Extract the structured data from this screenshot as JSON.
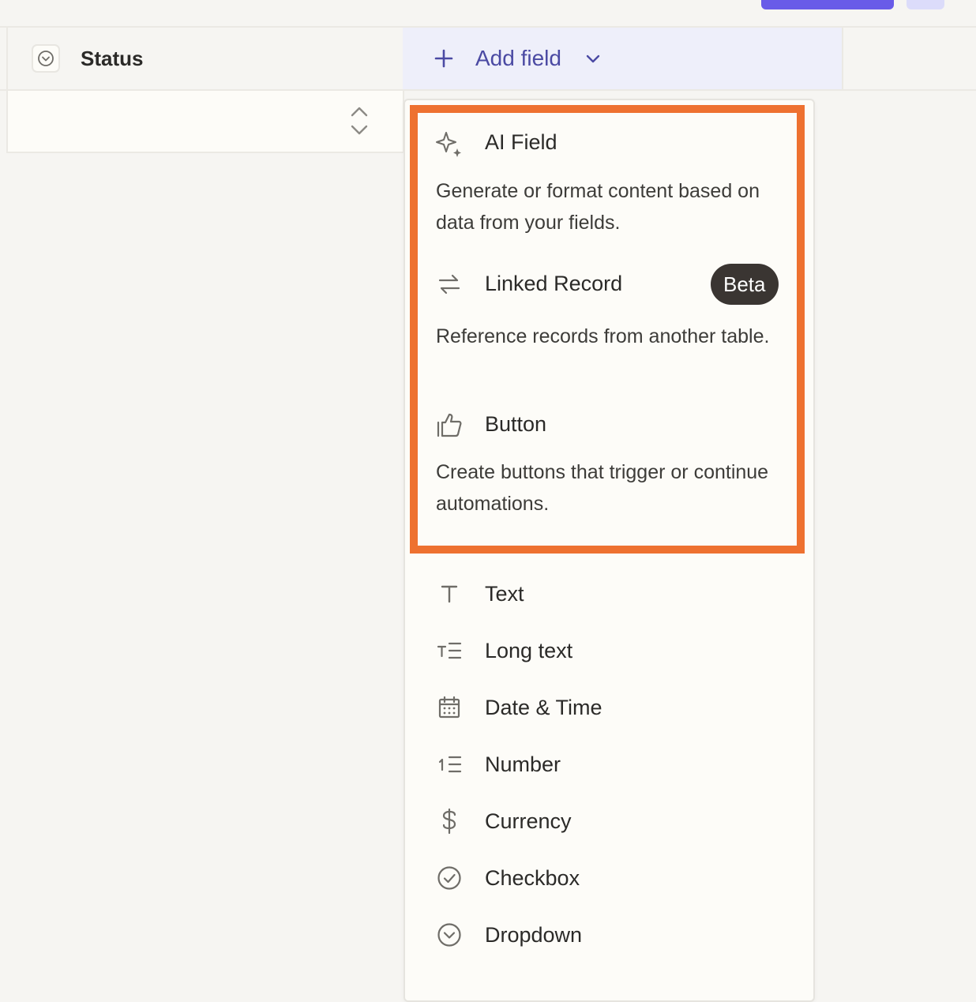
{
  "table": {
    "status_column": {
      "title": "Status",
      "icon": "dropdown-circle-icon"
    },
    "add_field": {
      "label": "Add field",
      "icon": "plus-icon",
      "menu_icon": "chevron-down-icon"
    }
  },
  "menu": {
    "highlighted_items": [
      {
        "label": "AI Field",
        "icon": "sparkle-icon",
        "description": "Generate or format content based on data from your fields."
      },
      {
        "label": "Linked Record",
        "icon": "arrows-swap-icon",
        "badge": "Beta",
        "description": "Reference records from another table."
      },
      {
        "label": "Button",
        "icon": "thumbs-up-icon",
        "description": "Create buttons that trigger or continue automations."
      }
    ],
    "items": [
      {
        "label": "Text",
        "icon": "text-icon"
      },
      {
        "label": "Long text",
        "icon": "long-text-icon"
      },
      {
        "label": "Date & Time",
        "icon": "calendar-icon"
      },
      {
        "label": "Number",
        "icon": "number-icon"
      },
      {
        "label": "Currency",
        "icon": "dollar-icon"
      },
      {
        "label": "Checkbox",
        "icon": "check-circle-icon"
      },
      {
        "label": "Dropdown",
        "icon": "chevron-circle-icon"
      }
    ]
  },
  "colors": {
    "highlight": "#ee7130",
    "accent": "#4b4aa3",
    "primary_button": "#695be8",
    "badge_bg": "#3a3532"
  }
}
